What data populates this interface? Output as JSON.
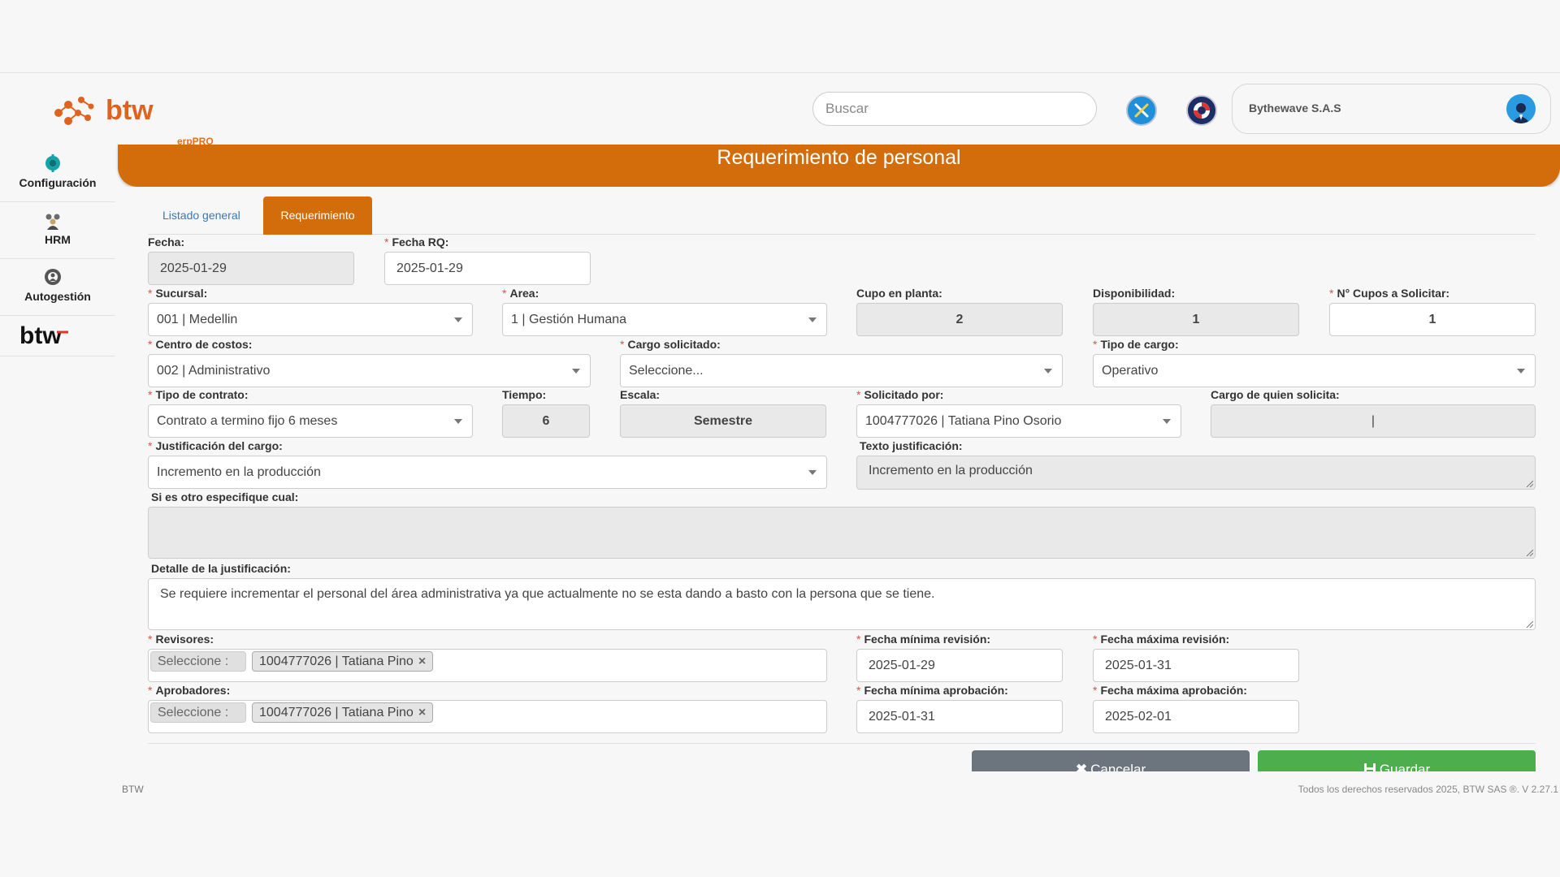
{
  "header": {
    "logo_text": "btw",
    "logo_sub": "erpPRO",
    "search_placeholder": "Buscar",
    "company_name": "Bythewave S.A.S"
  },
  "sidebar": {
    "items": [
      {
        "label": "Configuración",
        "icon": "gear-teal-icon"
      },
      {
        "label": "HRM",
        "icon": "people-icon"
      },
      {
        "label": "Autogestión",
        "icon": "gear-person-icon"
      }
    ],
    "brand": "btw"
  },
  "page": {
    "title": "Requerimiento de personal",
    "tabs": [
      "Listado general",
      "Requerimiento"
    ],
    "active_tab": "Requerimiento"
  },
  "form": {
    "fecha": {
      "label": "Fecha:",
      "value": "2025-01-29"
    },
    "fecha_rq": {
      "label": "Fecha RQ:",
      "value": "2025-01-29"
    },
    "sucursal": {
      "label": "Sucursal:",
      "value": "001 | Medellin"
    },
    "area": {
      "label": "Area:",
      "value": "1 | Gestión Humana"
    },
    "cupo_planta": {
      "label": "Cupo en planta:",
      "value": "2"
    },
    "disponibilidad": {
      "label": "Disponibilidad:",
      "value": "1"
    },
    "cupos_solicitar": {
      "label": "N° Cupos a Solicitar:",
      "value": "1"
    },
    "centro_costos": {
      "label": "Centro de costos:",
      "value": "002 | Administrativo"
    },
    "cargo_solicitado": {
      "label": "Cargo solicitado:",
      "value": "Seleccione..."
    },
    "tipo_cargo": {
      "label": "Tipo de cargo:",
      "value": "Operativo"
    },
    "tipo_contrato": {
      "label": "Tipo de contrato:",
      "value": "Contrato a termino fijo 6 meses"
    },
    "tiempo": {
      "label": "Tiempo:",
      "value": "6"
    },
    "escala": {
      "label": "Escala:",
      "value": "Semestre"
    },
    "solicitado_por": {
      "label": "Solicitado por:",
      "value": "1004777026 | Tatiana Pino Osorio"
    },
    "cargo_quien_solicita": {
      "label": "Cargo de quien solicita:",
      "value": "|"
    },
    "justificacion_cargo": {
      "label": "Justificación del cargo:",
      "value": "Incremento en la producción"
    },
    "texto_justificacion": {
      "label": "Texto justificación:",
      "value": "Incremento en la producción"
    },
    "otro_cual": {
      "label": "Si es otro especifique cual:",
      "value": ""
    },
    "detalle_justificacion": {
      "label": "Detalle de la justificación:",
      "value": "Se requiere incrementar el personal del área administrativa ya que actualmente no se esta dando a basto con la persona que se tiene."
    },
    "revisores": {
      "label": "Revisores:",
      "placeholder": "Seleccione :",
      "chips": [
        "1004777026 | Tatiana Pino"
      ]
    },
    "aprobadores": {
      "label": "Aprobadores:",
      "placeholder": "Seleccione :",
      "chips": [
        "1004777026 | Tatiana Pino"
      ]
    },
    "fecha_min_revision": {
      "label": "Fecha mínima revisión:",
      "value": "2025-01-29"
    },
    "fecha_max_revision": {
      "label": "Fecha máxima revisión:",
      "value": "2025-01-31"
    },
    "fecha_min_aprobacion": {
      "label": "Fecha mínima aprobación:",
      "value": "2025-01-31"
    },
    "fecha_max_aprobacion": {
      "label": "Fecha máxima aprobación:",
      "value": "2025-02-01"
    }
  },
  "buttons": {
    "cancel": "Cancelar",
    "save": "Guardar"
  },
  "footer": {
    "left": "BTW",
    "right": "Todos los derechos reservados 2025, BTW SAS ®. V 2.27.1"
  },
  "colors": {
    "brand_orange": "#d36d0b",
    "save_green": "#4cae4c",
    "cancel_gray": "#6c757d"
  }
}
